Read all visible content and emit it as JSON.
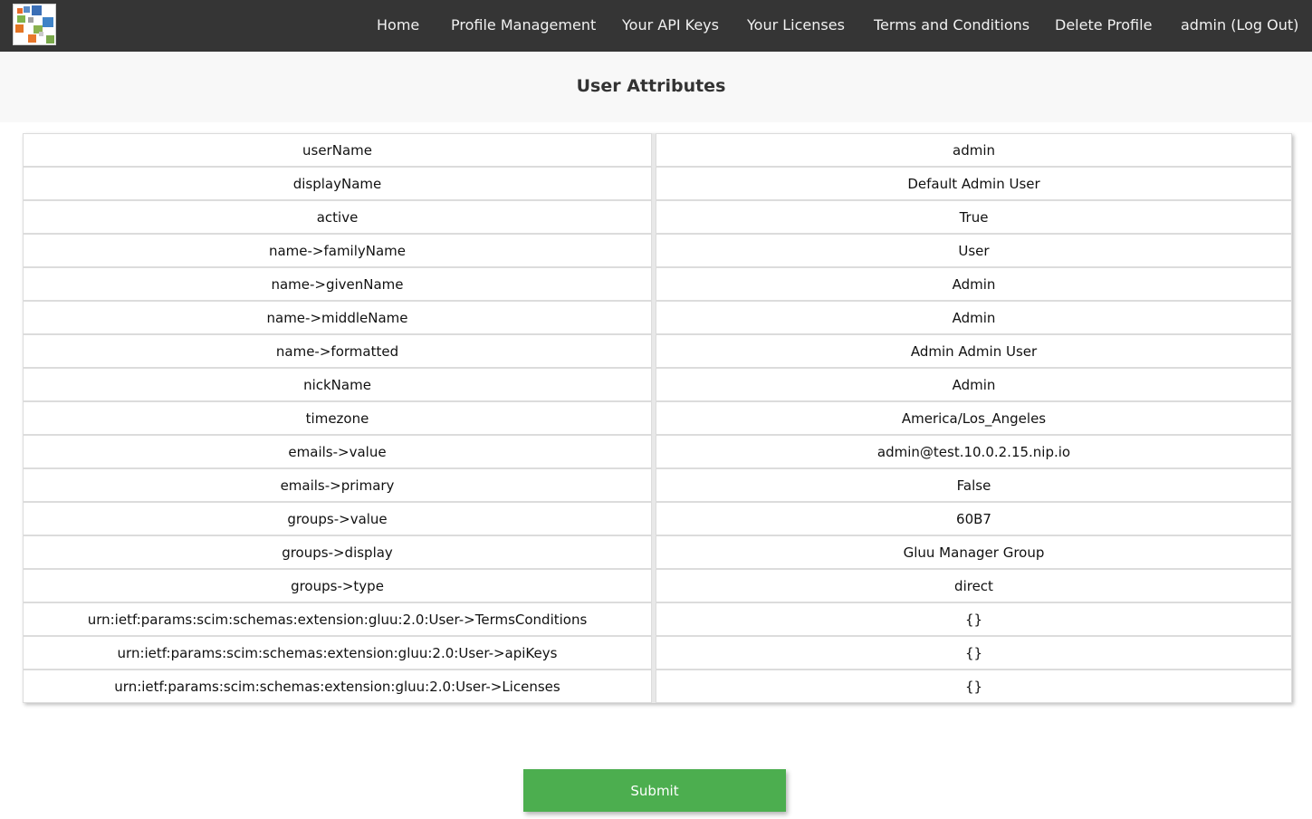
{
  "nav": {
    "items": [
      "Home",
      "Profile Management",
      "Your API Keys",
      "Your Licenses",
      "Terms and Conditions",
      "Delete Profile",
      "admin (Log Out)"
    ]
  },
  "page": {
    "title": "User Attributes"
  },
  "attributes": [
    {
      "key": "userName",
      "value": "admin"
    },
    {
      "key": "displayName",
      "value": "Default Admin User"
    },
    {
      "key": "active",
      "value": "True"
    },
    {
      "key": "name->familyName",
      "value": "User"
    },
    {
      "key": "name->givenName",
      "value": "Admin"
    },
    {
      "key": "name->middleName",
      "value": "Admin"
    },
    {
      "key": "name->formatted",
      "value": "Admin Admin User"
    },
    {
      "key": "nickName",
      "value": "Admin"
    },
    {
      "key": "timezone",
      "value": "America/Los_Angeles"
    },
    {
      "key": "emails->value",
      "value": "admin@test.10.0.2.15.nip.io"
    },
    {
      "key": "emails->primary",
      "value": "False"
    },
    {
      "key": "groups->value",
      "value": "60B7"
    },
    {
      "key": "groups->display",
      "value": "Gluu Manager Group"
    },
    {
      "key": "groups->type",
      "value": "direct"
    },
    {
      "key": "urn:ietf:params:scim:schemas:extension:gluu:2.0:User->TermsConditions",
      "value": "{}"
    },
    {
      "key": "urn:ietf:params:scim:schemas:extension:gluu:2.0:User->apiKeys",
      "value": "{}"
    },
    {
      "key": "urn:ietf:params:scim:schemas:extension:gluu:2.0:User->Licenses",
      "value": "{}"
    }
  ],
  "form": {
    "submit_label": "Submit"
  },
  "colors": {
    "navbar": "#353535",
    "submit": "#4cae4f",
    "banner": "#f8f8f8"
  }
}
